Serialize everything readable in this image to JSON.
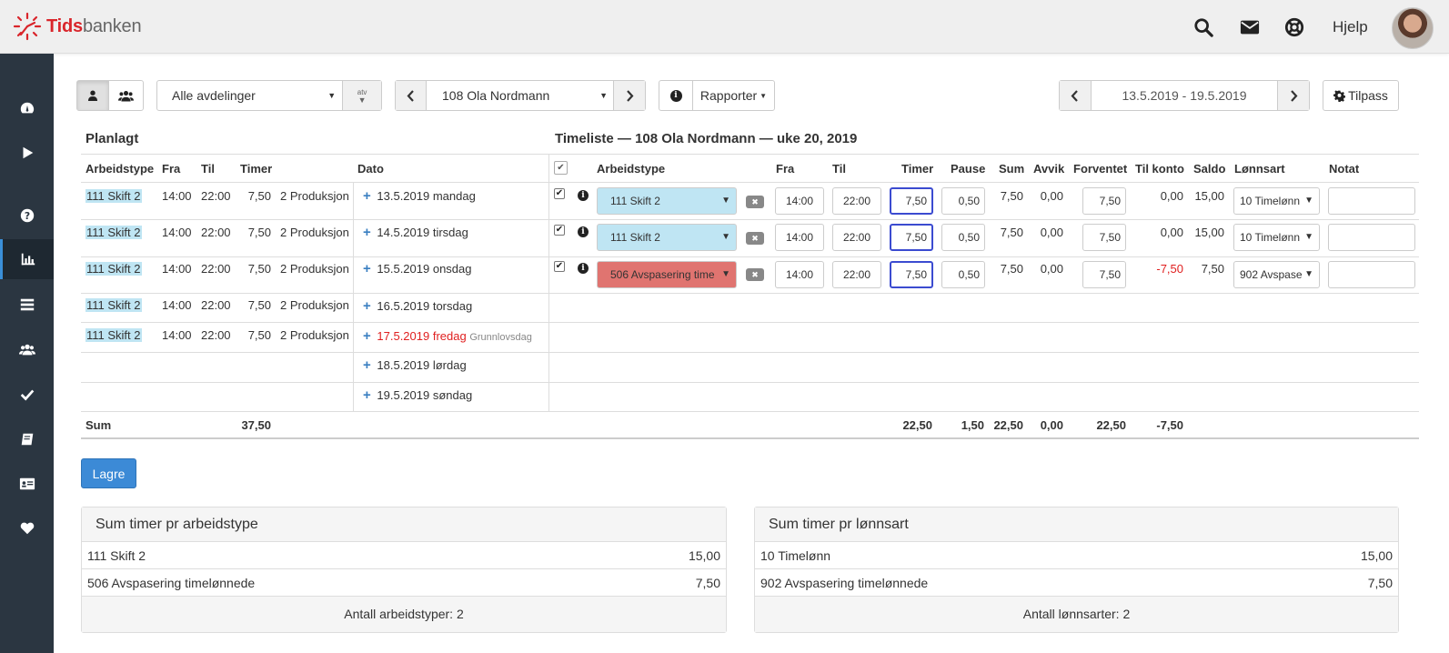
{
  "brand": {
    "name_bold": "Tids",
    "name_rest": "banken"
  },
  "topbar": {
    "help_label": "Hjelp",
    "icons": [
      "search-icon",
      "envelope-icon",
      "lifebuoy-icon",
      "avatar"
    ]
  },
  "sidebar": {
    "items": [
      "dashboard-icon",
      "play-icon",
      "question-icon",
      "bar-chart-icon",
      "list-icon",
      "users-icon",
      "check-icon",
      "book-icon",
      "id-card-icon",
      "heart-icon"
    ],
    "active": "bar-chart-icon"
  },
  "toolbar": {
    "department": "Alle avdelinger",
    "atv_label": "atv",
    "employee": "108 Ola Nordmann",
    "reports_label": "Rapporter",
    "date_range": "13.5.2019 - 19.5.2019",
    "customize_label": "Tilpass"
  },
  "planned": {
    "title": "Planlagt",
    "headers": {
      "type": "Arbeidstype",
      "from": "Fra",
      "to": "Til",
      "hours": "Timer",
      "date": "Dato"
    },
    "rows": [
      {
        "type": "111 Skift 2",
        "from": "14:00",
        "to": "22:00",
        "hours": "7,50",
        "dept": "2 Produksjon"
      },
      {
        "type": "111 Skift 2",
        "from": "14:00",
        "to": "22:00",
        "hours": "7,50",
        "dept": "2 Produksjon"
      },
      {
        "type": "111 Skift 2",
        "from": "14:00",
        "to": "22:00",
        "hours": "7,50",
        "dept": "2 Produksjon"
      },
      {
        "type": "111 Skift 2",
        "from": "14:00",
        "to": "22:00",
        "hours": "7,50",
        "dept": "2 Produksjon"
      },
      {
        "type": "111 Skift 2",
        "from": "14:00",
        "to": "22:00",
        "hours": "7,50",
        "dept": "2 Produksjon"
      }
    ],
    "dates": [
      {
        "date": "13.5.2019 mandag",
        "holiday": ""
      },
      {
        "date": "14.5.2019 tirsdag",
        "holiday": ""
      },
      {
        "date": "15.5.2019 onsdag",
        "holiday": ""
      },
      {
        "date": "16.5.2019 torsdag",
        "holiday": ""
      },
      {
        "date": "17.5.2019 fredag",
        "holiday": "Grunnlovsdag"
      },
      {
        "date": "18.5.2019 lørdag",
        "holiday": ""
      },
      {
        "date": "19.5.2019 søndag",
        "holiday": ""
      }
    ],
    "sum_label": "Sum",
    "sum_hours": "37,50"
  },
  "timesheet": {
    "title": "Timeliste — 108 Ola Nordmann — uke 20, 2019",
    "headers": {
      "type": "Arbeidstype",
      "from": "Fra",
      "to": "Til",
      "hours": "Timer",
      "pause": "Pause",
      "sum": "Sum",
      "dev": "Avvik",
      "expected": "Forventet",
      "to_account": "Til konto",
      "balance": "Saldo",
      "wage": "Lønnsart",
      "note": "Notat"
    },
    "rows": [
      {
        "type": "111 Skift 2",
        "type_color": "#bfe5f3",
        "from": "14:00",
        "to": "22:00",
        "hours": "7,50",
        "pause": "0,50",
        "sum": "7,50",
        "dev": "0,00",
        "expected": "7,50",
        "to_account": "0,00",
        "balance": "15,00",
        "wage": "10 Timelønn",
        "note": ""
      },
      {
        "type": "111 Skift 2",
        "type_color": "#bfe5f3",
        "from": "14:00",
        "to": "22:00",
        "hours": "7,50",
        "pause": "0,50",
        "sum": "7,50",
        "dev": "0,00",
        "expected": "7,50",
        "to_account": "0,00",
        "balance": "15,00",
        "wage": "10 Timelønn",
        "note": ""
      },
      {
        "type": "506 Avspasering time",
        "type_color": "#e07470",
        "from": "14:00",
        "to": "22:00",
        "hours": "7,50",
        "pause": "0,50",
        "sum": "7,50",
        "dev": "0,00",
        "expected": "7,50",
        "to_account": "-7,50",
        "balance": "7,50",
        "wage": "902 Avspase",
        "note": ""
      }
    ],
    "sums": {
      "hours": "22,50",
      "pause": "1,50",
      "sum": "22,50",
      "dev": "0,00",
      "expected": "22,50",
      "to_account": "-7,50"
    }
  },
  "save_label": "Lagre",
  "panel_types": {
    "title": "Sum timer pr arbeidstype",
    "rows": [
      {
        "label": "111 Skift 2",
        "value": "15,00"
      },
      {
        "label": "506 Avspasering timelønnede",
        "value": "7,50"
      }
    ],
    "footer": "Antall arbeidstyper: 2"
  },
  "panel_wages": {
    "title": "Sum timer pr lønnsart",
    "rows": [
      {
        "label": "10 Timelønn",
        "value": "15,00"
      },
      {
        "label": "902 Avspasering timelønnede",
        "value": "7,50"
      }
    ],
    "footer": "Antall lønnsarter: 2"
  },
  "colors": {
    "accent": "#3c8ad6",
    "sidebar": "#2b3641",
    "negative": "#e02020"
  }
}
